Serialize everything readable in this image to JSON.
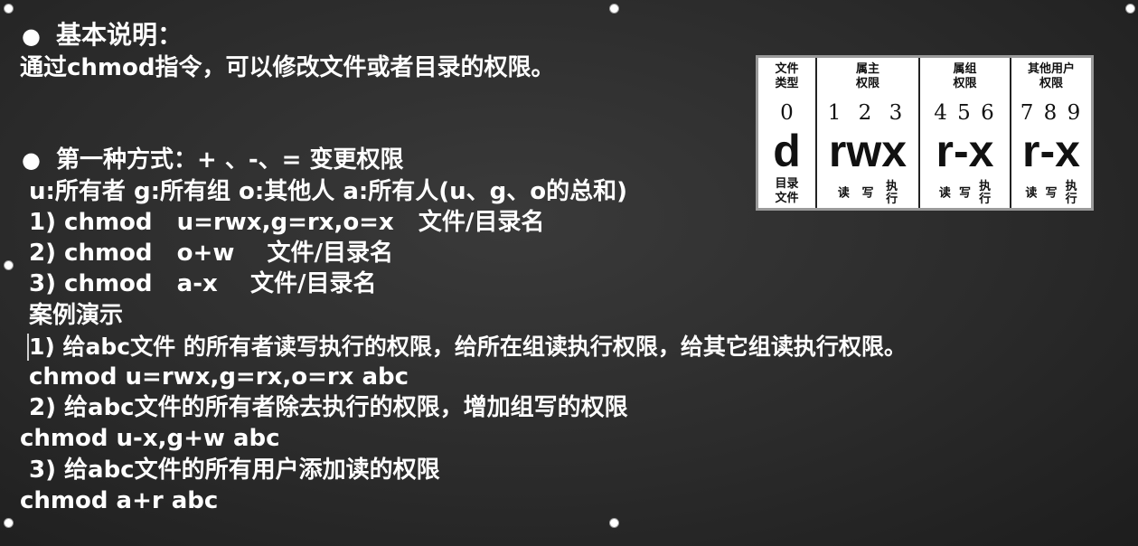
{
  "sections": {
    "basic": {
      "heading": "基本说明：",
      "text": "通过chmod指令，可以修改文件或者目录的权限。"
    },
    "method1": {
      "heading": "第一种方式：+ 、-、= 变更权限",
      "legend": "u:所有者  g:所有组  o:其他人  a:所有人(u、g、o的总和)",
      "commands": [
        "1) chmod   u=rwx,g=rx,o=x   文件/目录名",
        "2) chmod   o+w    文件/目录名",
        "3) chmod   a-x    文件/目录名"
      ]
    },
    "demo": {
      "title": "案例演示",
      "cases": [
        {
          "desc": "1) 给abc文件 的所有者读写执行的权限，给所在组读执行权限，给其它组读执行权限。",
          "cmd": "chmod u=rwx,g=rx,o=rx abc"
        },
        {
          "desc": "2) 给abc文件的所有者除去执行的权限，增加组写的权限",
          "cmd": "chmod u-x,g+w abc"
        },
        {
          "desc": "3) 给abc文件的所有用户添加读的权限",
          "cmd": "chmod a+r abc"
        }
      ]
    }
  },
  "permission_table": {
    "columns": [
      {
        "header": [
          "文件",
          "类型"
        ],
        "digits": "0",
        "letters": "d",
        "footer": [
          "目录",
          "文件"
        ]
      },
      {
        "header": [
          "属主",
          "权限"
        ],
        "digits": "1 2 3",
        "letters": "rwx",
        "footer": [
          "读",
          "写",
          "执",
          "行"
        ]
      },
      {
        "header": [
          "属组",
          "权限"
        ],
        "digits": "4 5 6",
        "letters": "r-x",
        "footer": [
          "读",
          "写",
          "执",
          "行"
        ]
      },
      {
        "header": [
          "其他用户",
          "权限"
        ],
        "digits": "7 8 9",
        "letters": "r-x",
        "footer": [
          "读",
          "写",
          "执",
          "行"
        ]
      }
    ]
  }
}
